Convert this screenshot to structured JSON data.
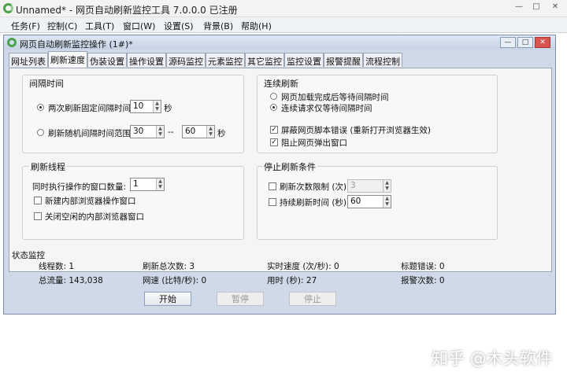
{
  "app": {
    "title": "Unnamed* - 网页自动刷新监控工具 7.0.0.0  已注册"
  },
  "window_controls": {
    "min": "—",
    "max": "□",
    "close": "✕"
  },
  "menu": [
    "任务(F)",
    "控制(C)",
    "工具(T)",
    "窗口(W)",
    "设置(S)",
    "背景(B)",
    "帮助(H)"
  ],
  "child": {
    "title": "网页自动刷新监控操作 (1#)*"
  },
  "tabs": [
    "网址列表",
    "刷新速度",
    "伪装设置",
    "操作设置",
    "源码监控",
    "元素监控",
    "其它监控",
    "监控设置",
    "报警提醒",
    "流程控制"
  ],
  "interval": {
    "title": "间隔时间",
    "fixed_label": "两次刷新固定间隔时间",
    "fixed_value": "10",
    "unit": "秒",
    "random_label": "刷新随机间隔时间范围",
    "random_min": "30",
    "dash": "--",
    "random_max": "60"
  },
  "continuous": {
    "title": "连续刷新",
    "opt1": "网页加载完成后等待间隔时间",
    "opt2": "连续请求仅等待间隔时间",
    "chk1": "屏蔽网页脚本错误 (重新打开浏览器生效)",
    "chk2": "阻止网页弹出窗口"
  },
  "threads": {
    "title": "刷新线程",
    "count_label": "同时执行操作的窗口数量:",
    "count_value": "1",
    "chk1": "新建内部浏览器操作窗口",
    "chk2": "关闭空闲的内部浏览器窗口"
  },
  "stop": {
    "title": "停止刷新条件",
    "chk1": "刷新次数限制 (次)",
    "val1": "3",
    "chk2": "持续刷新时间 (秒)",
    "val2": "60"
  },
  "status": {
    "title": "状态监控",
    "threads": "线程数:  1",
    "total_refresh": "刷新总次数:  3",
    "speed": "实时速度 (次/秒):  0",
    "title_errors": "标题错误:  0",
    "traffic": "总流量:  143,038",
    "net_speed": "网速 (比特/秒):  0",
    "elapsed": "用时 (秒):  27",
    "alarms": "报警次数:  0"
  },
  "buttons": {
    "start": "开始",
    "pause": "暂停",
    "stop": "停止"
  },
  "watermark": "知乎 @木头软件",
  "colors": {
    "accent": "#4aa34a",
    "child_bg": "#cfd9e8"
  }
}
